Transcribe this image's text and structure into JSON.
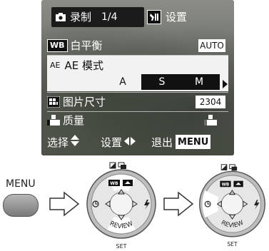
{
  "lcd": {
    "tabs": {
      "record_label": "录制",
      "page": "1/4",
      "setup_label": "设置"
    },
    "items": {
      "wb": {
        "icon_text": "WB",
        "label": "白平衡",
        "value": "AUTO"
      },
      "ae": {
        "icon_text": "AE",
        "label": "AE 模式",
        "options": [
          "A",
          "S",
          "M"
        ],
        "selected": "A"
      },
      "size": {
        "label": "图片尺寸",
        "value": "2304"
      },
      "quality": {
        "label": "质量"
      }
    },
    "footer": {
      "select_label": "选择",
      "set_label": "设置",
      "exit_label": "退出",
      "menu_label": "MENU"
    }
  },
  "left": {
    "menu_label": "MENU"
  },
  "dial1": {
    "review_label": "REVIEW",
    "set_label": "SET",
    "wb_chip": "WB"
  },
  "dial2": {
    "review_label": "REVIEW",
    "set_label": "SET",
    "wb_chip": "WB"
  }
}
